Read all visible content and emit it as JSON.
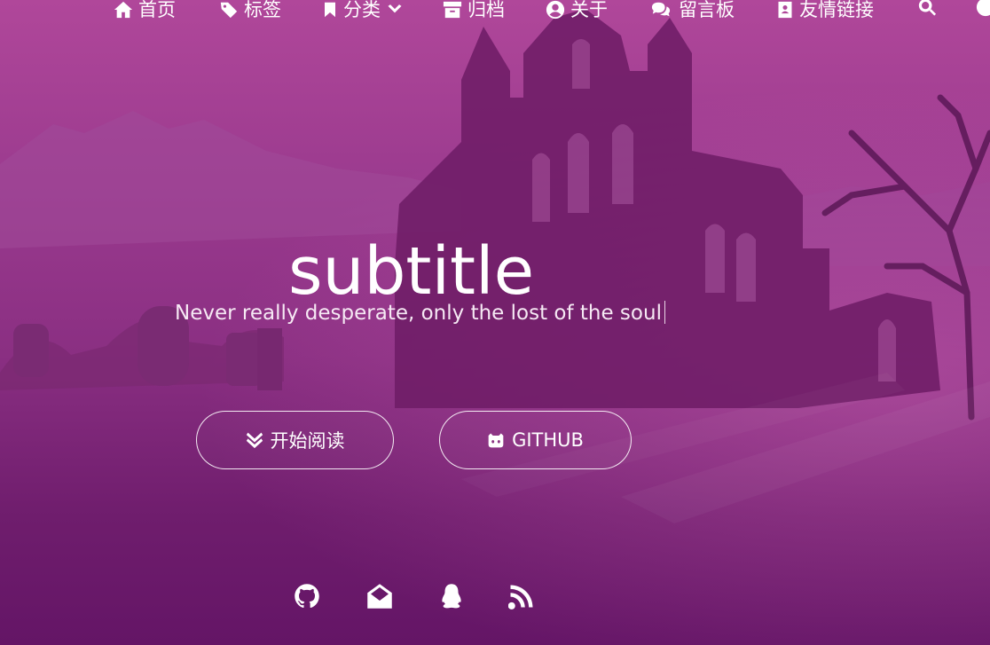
{
  "nav": {
    "items": [
      {
        "label": "首页",
        "icon": "home-icon"
      },
      {
        "label": "标签",
        "icon": "tags-icon"
      },
      {
        "label": "分类",
        "icon": "bookmark-icon",
        "dropdown": "chevron-down-icon"
      },
      {
        "label": "归档",
        "icon": "archive-icon"
      },
      {
        "label": "关于",
        "icon": "user-circle-icon"
      },
      {
        "label": "留言板",
        "icon": "comments-icon"
      },
      {
        "label": "友情链接",
        "icon": "address-book-icon"
      }
    ],
    "search_icon": "search-icon"
  },
  "hero": {
    "title": "subtitle",
    "subtitle": "Never really desperate, only the lost of the soul"
  },
  "buttons": {
    "read_label": "开始阅读",
    "read_icon": "double-chevron-down-icon",
    "github_label": "GITHUB",
    "github_icon": "github-cat-icon"
  },
  "social": [
    "github-icon",
    "envelope-open-icon",
    "qq-icon",
    "rss-icon"
  ],
  "colors": {
    "overlay_top": "#b0479a",
    "overlay_bottom": "#641566",
    "text": "#ffffff"
  }
}
